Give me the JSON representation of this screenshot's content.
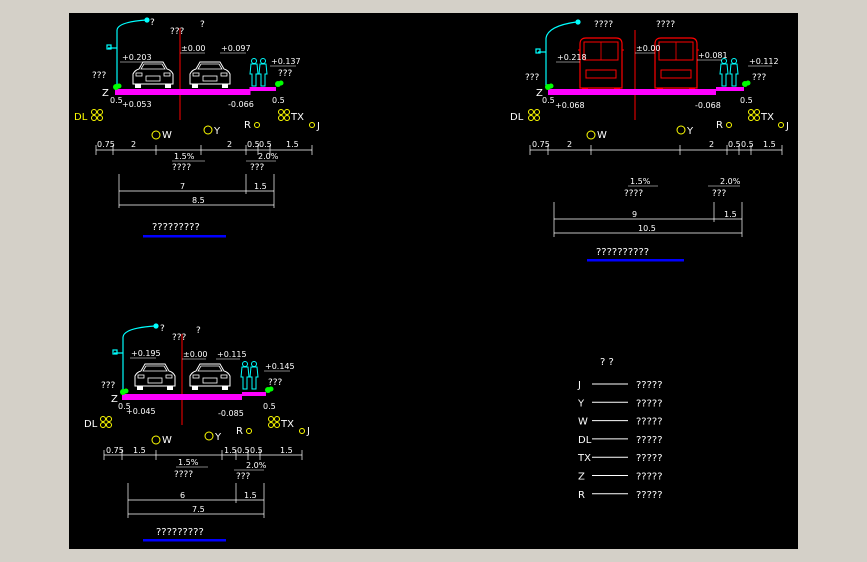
{
  "colors": {
    "background": "#000000",
    "frame": "#d4d0c8",
    "road": "#ff00ff",
    "text": "#ffffff",
    "yellow": "#ffff00",
    "cyan": "#00ffff",
    "red": "#ff0000",
    "green": "#00ff00",
    "underline": "#0000ff"
  },
  "icons": [
    "street-lamp-icon",
    "car-icon",
    "bus-icon",
    "pedestrian-icon",
    "tree-icon",
    "utility-circle-icon"
  ],
  "sections": [
    {
      "id": "section-a",
      "lamp_label": "?",
      "center_label": "???",
      "center_label2": "?",
      "left_elev": "+0.203",
      "center_elev": "±0.00",
      "right_elev": "+0.097",
      "far_right_elev": "+0.137",
      "left_q": "???",
      "right_q": "???",
      "bottom_left_elev": "+0.053",
      "bottom_right_elev": "-0.066",
      "z_label": "Z",
      "d05_left": "0.5",
      "d05_right": "0.5",
      "dl_label": "DL",
      "tx_label": "TX",
      "r_label": "R",
      "w_label": "W",
      "y_label": "Y",
      "j_label": "J",
      "dims_top": [
        "0.75",
        "2",
        "2",
        "0.5",
        "0.5",
        "1.5"
      ],
      "slope_left": "1.5%",
      "slope_right": "2.0%",
      "slope_left_q": "????",
      "slope_right_q": "???",
      "dim_road": "7",
      "dim_walk": "1.5",
      "dim_total": "8.5",
      "title": "?????????"
    },
    {
      "id": "section-b",
      "lamp_label": "",
      "center_label": "????",
      "center_label2": "????",
      "left_elev": "+0.218",
      "center_elev": "±0.00",
      "right_elev": "+0.081",
      "far_right_elev": "+0.112",
      "left_q": "???",
      "right_q": "???",
      "bottom_left_elev": "+0.068",
      "bottom_right_elev": "-0.068",
      "z_label": "Z",
      "d05_left": "0.5",
      "d05_right": "0.5",
      "dl_label": "DL",
      "tx_label": "TX",
      "r_label": "R",
      "w_label": "W",
      "y_label": "Y",
      "j_label": "J",
      "dims_top": [
        "0.75",
        "2",
        "2",
        "0.5",
        "0.5",
        "1.5"
      ],
      "slope_left": "1.5%",
      "slope_right": "2.0%",
      "slope_left_q": "????",
      "slope_right_q": "???",
      "dim_road": "9",
      "dim_walk": "1.5",
      "dim_total": "10.5",
      "title": "??????????"
    },
    {
      "id": "section-c",
      "lamp_label": "?",
      "center_label": "???",
      "center_label2": "?",
      "left_elev": "+0.195",
      "center_elev": "±0.00",
      "right_elev": "+0.115",
      "far_right_elev": "+0.145",
      "left_q": "???",
      "right_q": "???",
      "bottom_left_elev": "+0.045",
      "bottom_right_elev": "-0.085",
      "z_label": "Z",
      "d05_left": "0.5",
      "d05_right": "0.5",
      "dl_label": "DL",
      "tx_label": "TX",
      "r_label": "R",
      "w_label": "W",
      "y_label": "Y",
      "j_label": "J",
      "dims_top": [
        "0.75",
        "1.5",
        "1.5",
        "0.5",
        "0.5",
        "1.5"
      ],
      "slope_left": "1.5%",
      "slope_right": "2.0%",
      "slope_left_q": "????",
      "slope_right_q": "???",
      "dim_road": "6",
      "dim_walk": "1.5",
      "dim_total": "7.5",
      "title": "?????????"
    }
  ],
  "legend": {
    "title": "? ?",
    "items": [
      {
        "code": "J",
        "desc": "?????"
      },
      {
        "code": "Y",
        "desc": "?????"
      },
      {
        "code": "W",
        "desc": "?????"
      },
      {
        "code": "DL",
        "desc": "?????"
      },
      {
        "code": "TX",
        "desc": "?????"
      },
      {
        "code": "Z",
        "desc": "?????"
      },
      {
        "code": "R",
        "desc": "?????"
      }
    ]
  }
}
